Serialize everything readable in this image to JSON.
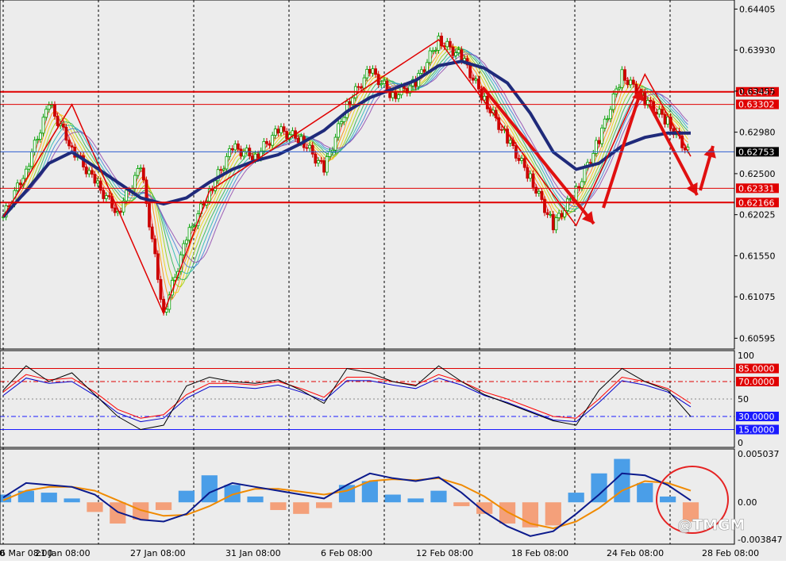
{
  "chart_data": {
    "type": "candlestick",
    "watermark": "@TMGM",
    "colors": {
      "background": "#ececec",
      "panel_border": "#000000",
      "up_candle": "#00a000",
      "down_candle": "#cc0000",
      "level_line": "#e00000",
      "current_price_line": "#2f5fd0",
      "ma_slow": "#1f2a7a",
      "arrow": "#e01010",
      "stoch_k": "#000000",
      "stoch_d": "#ff0000",
      "stoch_signal": "#0000cc",
      "macd_line": "#0b1a8c",
      "macd_signal": "#f08a00",
      "hist_pos": "#4a9ee8",
      "hist_neg": "#f4a07a",
      "oversold_label_bg": "#1a1aff",
      "overbought_label_bg": "#e00000"
    },
    "x_tick_labels": [
      "00",
      "21 Jan 08:00",
      "27 Jan 08:00",
      "31 Jan 08:00",
      "6 Feb 08:00",
      "12 Feb 08:00",
      "18 Feb 08:00",
      "24 Feb 08:00",
      "28 Feb 08:00",
      "6 Mar 08:00"
    ],
    "main_panel": {
      "y_axis_labels": [
        "0.64405",
        "0.63930",
        "0.63455",
        "0.62980",
        "0.62500",
        "0.62025",
        "0.61550",
        "0.61075",
        "0.60595"
      ],
      "ylim": [
        0.6047,
        0.6451
      ],
      "price_levels": [
        {
          "label": "0.63447",
          "value": 0.63447
        },
        {
          "label": "0.63302",
          "value": 0.63302
        },
        {
          "label": "0.62331",
          "value": 0.62331
        },
        {
          "label": "0.62166",
          "value": 0.62166
        }
      ],
      "current_price": {
        "label": "0.62753",
        "value": 0.62753
      },
      "price_path": [
        0.62,
        0.6255,
        0.633,
        0.628,
        0.624,
        0.6205,
        0.6258,
        0.6088,
        0.6175,
        0.623,
        0.628,
        0.627,
        0.63,
        0.629,
        0.6255,
        0.633,
        0.637,
        0.634,
        0.6355,
        0.6405,
        0.6385,
        0.6335,
        0.629,
        0.6245,
        0.619,
        0.623,
        0.629,
        0.6365,
        0.6335,
        0.631,
        0.627
      ],
      "ma_slow": [
        0.62,
        0.623,
        0.6262,
        0.6275,
        0.6258,
        0.624,
        0.6222,
        0.6215,
        0.6222,
        0.624,
        0.6255,
        0.6265,
        0.6272,
        0.6285,
        0.63,
        0.6322,
        0.6338,
        0.6348,
        0.6358,
        0.6375,
        0.638,
        0.6372,
        0.6355,
        0.632,
        0.6275,
        0.6255,
        0.6262,
        0.6282,
        0.6292,
        0.6297,
        0.6297
      ],
      "zigzag": [
        {
          "bar": 0,
          "price": 0.62
        },
        {
          "bar": 3,
          "price": 0.633
        },
        {
          "bar": 7,
          "price": 0.6088
        },
        {
          "bar": 9,
          "price": 0.623
        },
        {
          "bar": 19,
          "price": 0.6405
        },
        {
          "bar": 25,
          "price": 0.619
        },
        {
          "bar": 28,
          "price": 0.6365
        },
        {
          "bar": 30,
          "price": 0.627
        }
      ]
    },
    "stochastic_panel": {
      "y_axis_labels": [
        "100",
        "50",
        "0"
      ],
      "ylim": [
        0,
        100
      ],
      "levels": [
        {
          "label": "85.0000",
          "value": 85
        },
        {
          "label": "70.0000",
          "value": 70
        },
        {
          "label": "30.0000",
          "value": 30
        },
        {
          "label": "15.0000",
          "value": 15
        }
      ],
      "k": [
        60,
        88,
        70,
        80,
        55,
        30,
        15,
        20,
        65,
        75,
        70,
        68,
        72,
        60,
        45,
        85,
        80,
        70,
        65,
        88,
        70,
        55,
        45,
        35,
        25,
        20,
        60,
        85,
        70,
        60,
        30
      ],
      "d": [
        58,
        78,
        72,
        74,
        58,
        38,
        28,
        32,
        55,
        68,
        68,
        66,
        70,
        62,
        52,
        75,
        75,
        70,
        66,
        78,
        70,
        58,
        50,
        40,
        30,
        28,
        50,
        75,
        70,
        62,
        45
      ]
    },
    "macd_panel": {
      "y_axis_labels": [
        "0.005037",
        "0.00",
        "-0.003847"
      ],
      "ylim": [
        -0.003847,
        0.005037
      ],
      "histogram": [
        0.0008,
        0.0012,
        0.001,
        0.0004,
        -0.001,
        -0.0022,
        -0.0018,
        -0.0008,
        0.0012,
        0.0028,
        0.0018,
        0.0006,
        -0.0008,
        -0.0012,
        -0.0006,
        0.0018,
        0.0022,
        0.0008,
        0.0004,
        0.0012,
        -0.0004,
        -0.0012,
        -0.0022,
        -0.0026,
        -0.0024,
        0.001,
        0.003,
        0.0045,
        0.002,
        0.0006,
        -0.002
      ],
      "macd": [
        0.0005,
        0.002,
        0.0018,
        0.0016,
        0.0008,
        -0.001,
        -0.0018,
        -0.002,
        -0.0012,
        0.001,
        0.002,
        0.0016,
        0.0012,
        0.0008,
        0.0004,
        0.0018,
        0.003,
        0.0025,
        0.0022,
        0.0026,
        0.001,
        -0.001,
        -0.0025,
        -0.0035,
        -0.003,
        -0.0012,
        0.0008,
        0.003,
        0.0028,
        0.0018,
        0.0002
      ],
      "signal": [
        0.0002,
        0.0012,
        0.0016,
        0.0016,
        0.0012,
        0.0002,
        -0.0008,
        -0.0014,
        -0.0013,
        -0.0004,
        0.0008,
        0.0014,
        0.0014,
        0.0011,
        0.0008,
        0.0012,
        0.0022,
        0.0024,
        0.0023,
        0.0025,
        0.0018,
        0.0006,
        -0.001,
        -0.0022,
        -0.0027,
        -0.002,
        -0.0006,
        0.0012,
        0.0022,
        0.002,
        0.0012
      ]
    }
  }
}
